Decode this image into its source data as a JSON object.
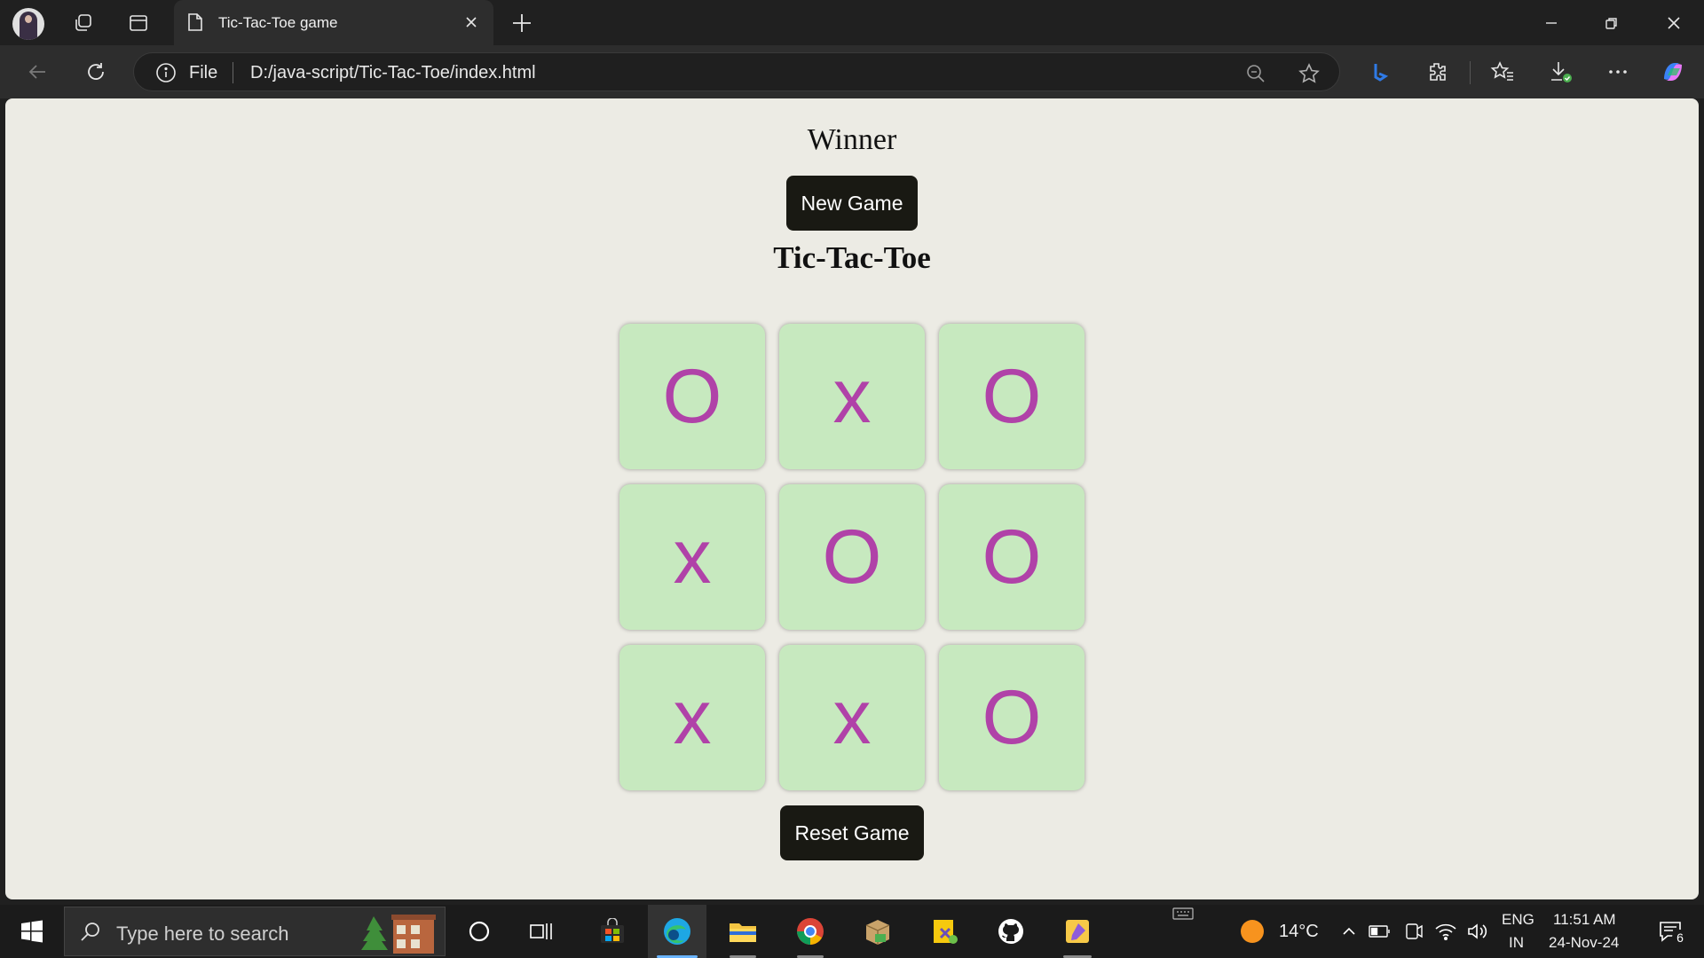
{
  "browser": {
    "tab_title": "Tic-Tac-Toe game",
    "address_scheme": "File",
    "address_url": "D:/java-script/Tic-Tac-Toe/index.html"
  },
  "page": {
    "message": "Winner",
    "new_game_label": "New Game",
    "title": "Tic-Tac-Toe",
    "reset_label": "Reset Game",
    "cells": [
      "O",
      "x",
      "O",
      "x",
      "O",
      "O",
      "x",
      "x",
      "O"
    ]
  },
  "taskbar": {
    "search_placeholder": "Type here to search",
    "weather": "14°C",
    "lang_line1": "ENG",
    "lang_line2": "IN",
    "time": "11:51 AM",
    "date": "24-Nov-24",
    "notifications": "6"
  },
  "colors": {
    "page_bg": "#ecebe4",
    "cell_bg": "#c7e9bf",
    "mark": "#b042a8",
    "button_bg": "#191913"
  }
}
